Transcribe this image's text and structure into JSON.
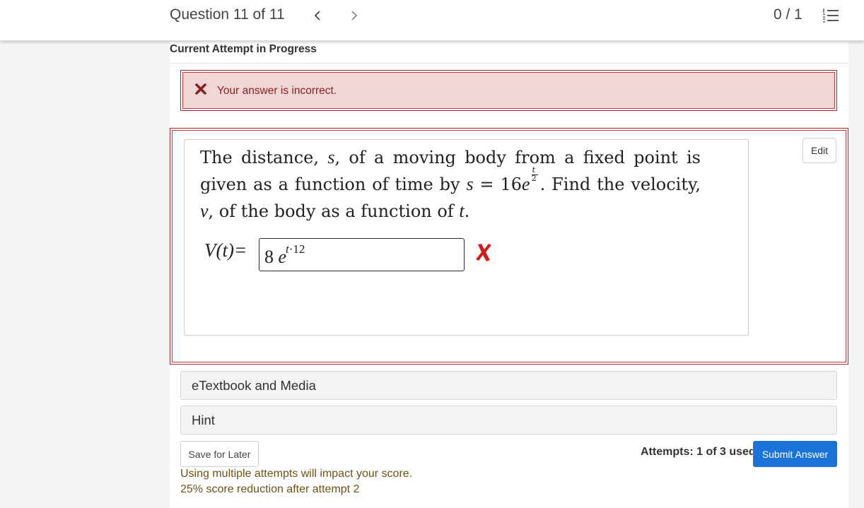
{
  "header": {
    "question_label": "Question 11 of 11",
    "score": "0 / 1",
    "prev_icon": "chevron-left-icon",
    "next_icon": "chevron-right-icon",
    "list_icon": "numbered-list-icon"
  },
  "attempt_heading": "Current Attempt in Progress",
  "feedback": {
    "message": "Your answer is incorrect.",
    "icon": "x-mark-icon",
    "color": "#b1262a"
  },
  "question": {
    "text_part1": "The distance,",
    "var_s": "s",
    "text_part2": ", of a moving body from a fixed point is given as a function of time by",
    "eq_lhs": "s",
    "eq_op": " = ",
    "eq_coef": "16",
    "eq_base": "e",
    "exp_num": "t",
    "exp_den": "2",
    "text_part3": ". Find the velocity,",
    "var_v": "v",
    "text_part4": ", of the body as a function of",
    "var_t": "t",
    "text_end": ".",
    "answer_label": "V(t)=",
    "answer_value_base": "8 ",
    "answer_value_e": "e",
    "answer_value_exp_var": "t",
    "answer_value_exp_rest": "·12",
    "edit_label": "Edit"
  },
  "sections": [
    {
      "label": "eTextbook and Media"
    },
    {
      "label": "Hint"
    }
  ],
  "footer": {
    "save_label": "Save for Later",
    "attempts_text": "Attempts: 1 of 3 used",
    "submit_label": "Submit Answer",
    "warning_line1": "Using multiple attempts will impact your score.",
    "warning_line2": "25% score reduction after attempt 2"
  },
  "colors": {
    "accent": "#1a73d9",
    "error": "#b1262a",
    "error_bg": "#f1d6d6",
    "warning_text": "#6b5218"
  }
}
